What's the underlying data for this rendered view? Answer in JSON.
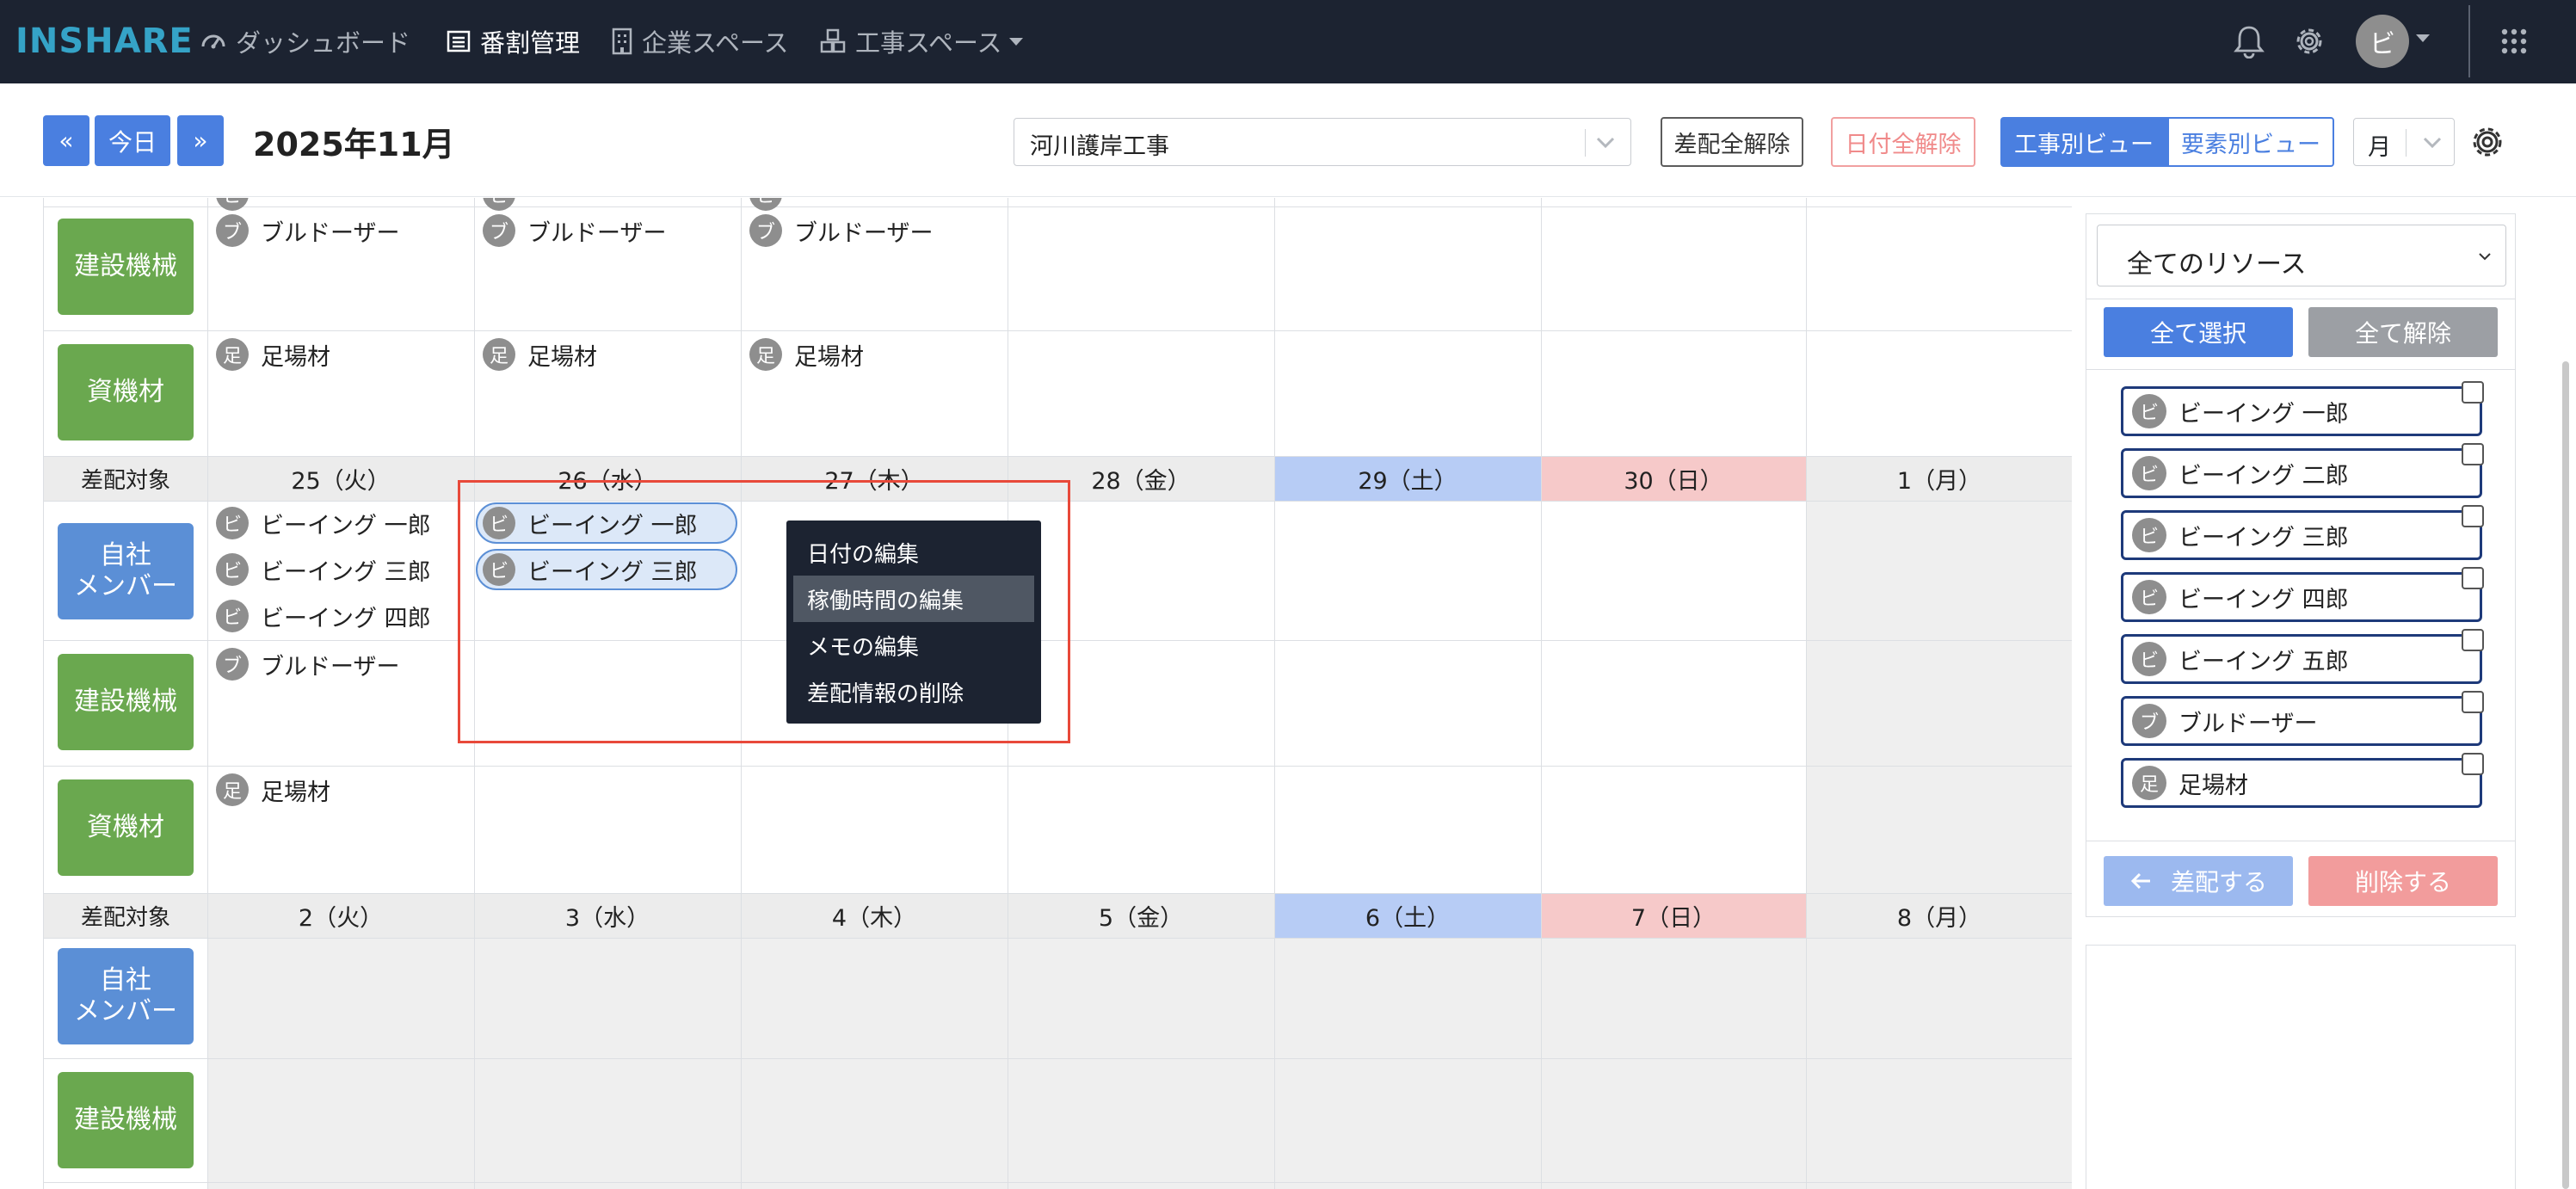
{
  "app": {
    "logo": "INSHARE",
    "nav": {
      "dashboard": "ダッシュボード",
      "assignment": "番割管理",
      "company": "企業スペース",
      "construction": "工事スペース"
    },
    "user_initial": "ビ"
  },
  "toolbar": {
    "prev": "«",
    "today": "今日",
    "next": "»",
    "month_title": "2025年11月",
    "project_select": "河川護岸工事",
    "clear_all_assign": "差配全解除",
    "clear_all_dates": "日付全解除",
    "view_by_project": "工事別ビュー",
    "view_by_element": "要素別ビュー",
    "period": "月"
  },
  "calendar": {
    "label_assign_target": "差配対象",
    "categories": {
      "member": "自社\nメンバー",
      "machine": "建設機械",
      "material": "資機材"
    },
    "week1": {
      "machine": [
        "ブルドーザー",
        "ブルドーザー",
        "ブルドーザー"
      ],
      "material": [
        "足場材",
        "足場材",
        "足場材"
      ]
    },
    "week2": {
      "dates": [
        "25（火）",
        "26（水）",
        "27（木）",
        "28（金）",
        "29（土）",
        "30（日）",
        "1（月）"
      ],
      "members_col1": [
        "ビーイング 一郎",
        "ビーイング 三郎",
        "ビーイング 四郎"
      ],
      "members_col2": [
        "ビーイング 一郎",
        "ビーイング 三郎"
      ],
      "machine_col1": "ブルドーザー",
      "material_col1": "足場材"
    },
    "week3": {
      "dates": [
        "2（火）",
        "3（水）",
        "4（木）",
        "5（金）",
        "6（土）",
        "7（日）",
        "8（月）"
      ]
    },
    "badges": {
      "member": "ビ",
      "machine": "ブ",
      "material": "足"
    }
  },
  "context_menu": {
    "items": [
      "日付の編集",
      "稼働時間の編集",
      "メモの編集",
      "差配情報の削除"
    ]
  },
  "panel": {
    "resource_select": "全てのリソース",
    "select_all": "全て選択",
    "deselect_all": "全て解除",
    "resources": [
      {
        "badge": "ビ",
        "name": "ビーイング 一郎"
      },
      {
        "badge": "ビ",
        "name": "ビーイング 二郎"
      },
      {
        "badge": "ビ",
        "name": "ビーイング 三郎"
      },
      {
        "badge": "ビ",
        "name": "ビーイング 四郎"
      },
      {
        "badge": "ビ",
        "name": "ビーイング 五郎"
      },
      {
        "badge": "ブ",
        "name": "ブルドーザー"
      },
      {
        "badge": "足",
        "name": "足場材"
      }
    ],
    "assign": "差配する",
    "delete": "削除する"
  }
}
